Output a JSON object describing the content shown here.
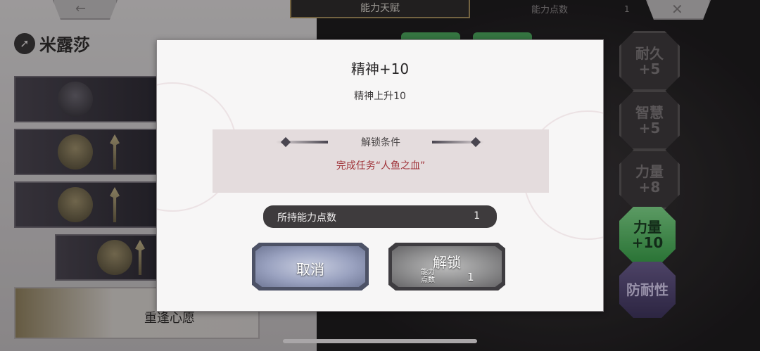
{
  "header": {
    "tab_title": "能力天赋",
    "points_label": "能力点数",
    "points_value": "1",
    "back_icon": "arrow-left-icon",
    "close_icon": "close-icon"
  },
  "character": {
    "name": "米露莎",
    "icon": "spear-emblem-icon"
  },
  "list": {
    "bottom_item_label": "重逢心愿"
  },
  "skill_tree": {
    "nodes": [
      {
        "label_top": "耐久",
        "label_bottom": "+5"
      },
      {
        "label_top": "智慧",
        "label_bottom": "+5"
      },
      {
        "label_top": "力量",
        "label_bottom": "+8"
      },
      {
        "label_top": "力量",
        "label_bottom": "+10"
      },
      {
        "label_top": "防耐性",
        "label_bottom": ""
      }
    ]
  },
  "dialog": {
    "title": "精神+10",
    "description": "精神上升10",
    "condition_title": "解锁条件",
    "condition_text": "完成任务“人鱼之血”",
    "owned_points_label": "所持能力点数",
    "owned_points_value": "1",
    "cancel_label": "取消",
    "unlock_label": "解锁",
    "unlock_cost_label": "能力点数",
    "unlock_cost_value": "1"
  },
  "colors": {
    "condition_text": "#a0343a",
    "dialog_bg": "#f7f6f6",
    "points_bar": "#3e3b3d",
    "cancel_button": "#9aa2c0",
    "unlock_button": "#8e8e8f",
    "active_node": "#3aa04a"
  }
}
